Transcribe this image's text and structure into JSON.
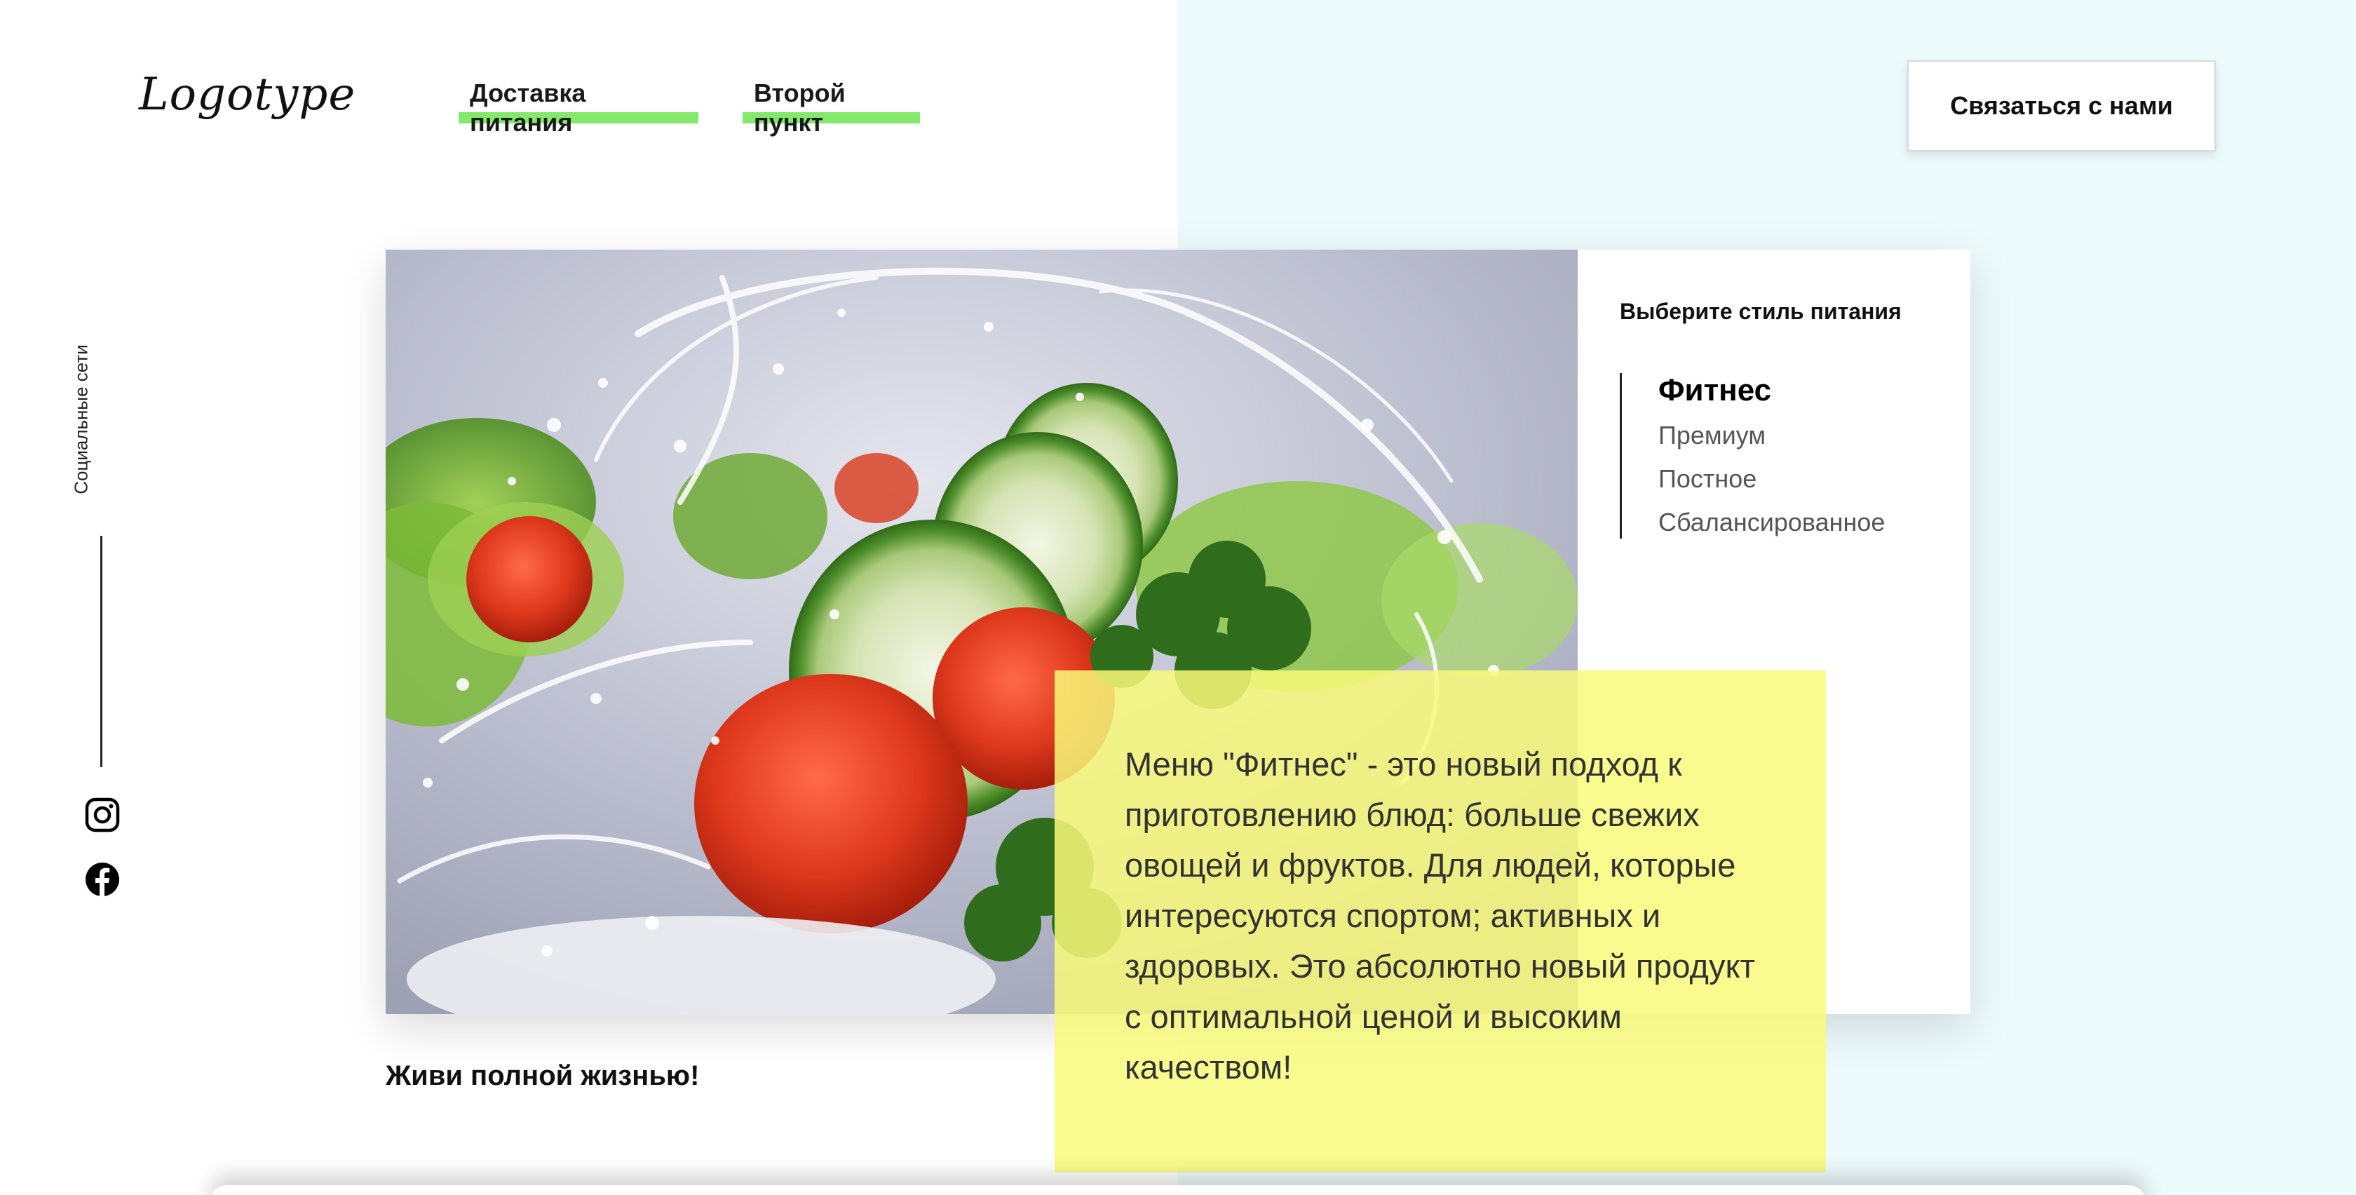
{
  "header": {
    "logo": "Logotype",
    "nav": [
      {
        "label": "Доставка питания"
      },
      {
        "label": "Второй пункт"
      }
    ],
    "contact_label": "Связаться с нами",
    "accent_color": "#84e86a"
  },
  "social": {
    "label": "Социальные сети",
    "icons": [
      "instagram-icon",
      "facebook-icon"
    ]
  },
  "menu": {
    "title": "Выберите стиль питания",
    "options": [
      "Фитнес",
      "Премиум",
      "Постное",
      "Сбалансированное"
    ],
    "selected": "Фитнес"
  },
  "description": "Меню \"Фитнес\" - это новый подход к приготовлению блюд: больше свежих овощей и фруктов. Для людей, которые интересуются спортом; активных и здоровых. Это абсолютно новый продукт с оптимальной ценой и высоким качеством!",
  "tagline": "Живи полной жизнью!",
  "colors": {
    "highlight_box": "#f9fa7a",
    "right_background": "#eefbfd"
  }
}
